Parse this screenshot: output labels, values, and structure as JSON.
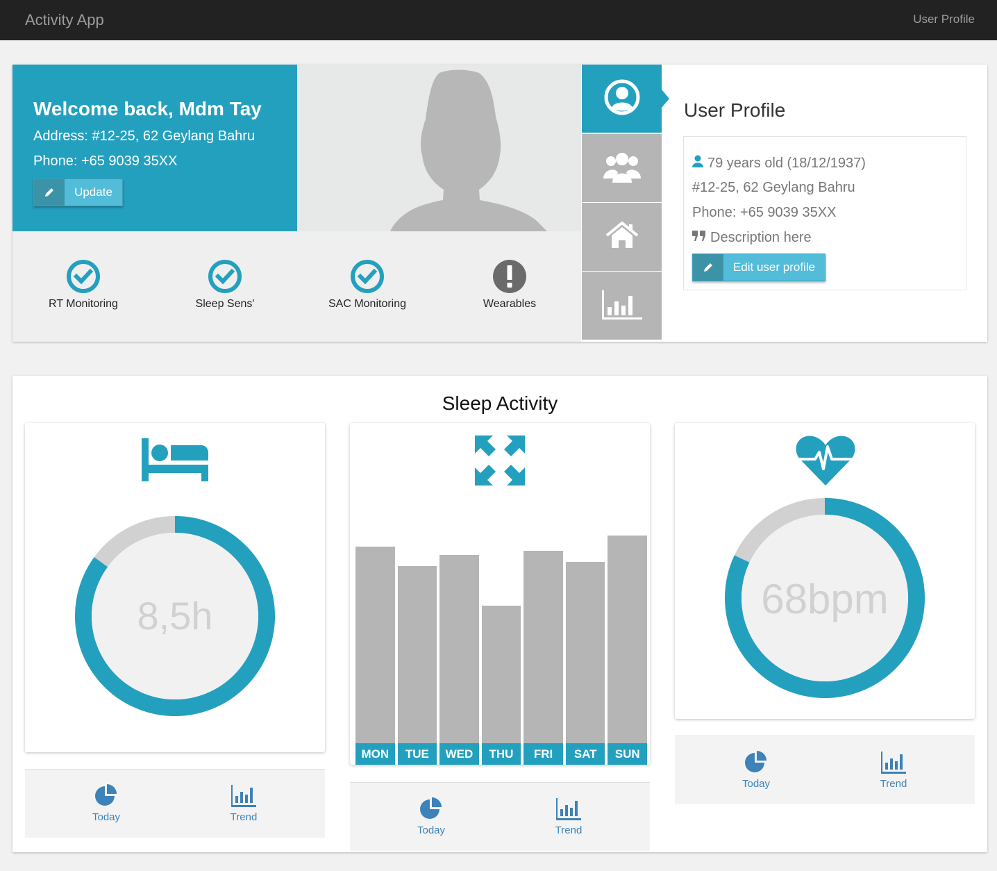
{
  "navbar": {
    "brand": "Activity App",
    "right_link": "User Profile"
  },
  "welcome": {
    "title": "Welcome back, Mdm Tay",
    "address": "Address: #12-25, 62 Geylang Bahru",
    "phone": "Phone: +65 9039 35XX",
    "update_label": "Update"
  },
  "status": [
    {
      "label": "RT Monitoring",
      "state": "ok"
    },
    {
      "label": "Sleep Sens'",
      "state": "ok"
    },
    {
      "label": "SAC Monitoring",
      "state": "ok"
    },
    {
      "label": "Wearables",
      "state": "warning"
    }
  ],
  "side_tabs": [
    {
      "icon": "user-circle-icon",
      "active": true
    },
    {
      "icon": "users-icon",
      "active": false
    },
    {
      "icon": "home-icon",
      "active": false
    },
    {
      "icon": "bar-chart-icon",
      "active": false
    }
  ],
  "profile": {
    "title": "User Profile",
    "age": "79 years old (18/12/1937)",
    "address": "#12-25, 62 Geylang Bahru",
    "phone": "Phone: +65 9039 35XX",
    "description": "Description here",
    "edit_label": "Edit user profile"
  },
  "sleep": {
    "title": "Sleep Activity",
    "duration": {
      "value": "8,5h",
      "fraction": 0.85
    },
    "heart_rate": {
      "value": "68bpm",
      "fraction": 0.82
    },
    "footer": {
      "today": "Today",
      "trend": "Trend"
    }
  },
  "colors": {
    "accent": "#24a0bf",
    "grey": "#b5b5b5",
    "link": "#3d82b8"
  },
  "chart_data": {
    "type": "bar",
    "categories": [
      "MON",
      "TUE",
      "WED",
      "THU",
      "FRI",
      "SAT",
      "SUN"
    ],
    "values": [
      9.0,
      8.1,
      8.6,
      6.3,
      8.8,
      8.3,
      9.5
    ],
    "ylim": [
      0,
      10
    ],
    "grid": false
  }
}
